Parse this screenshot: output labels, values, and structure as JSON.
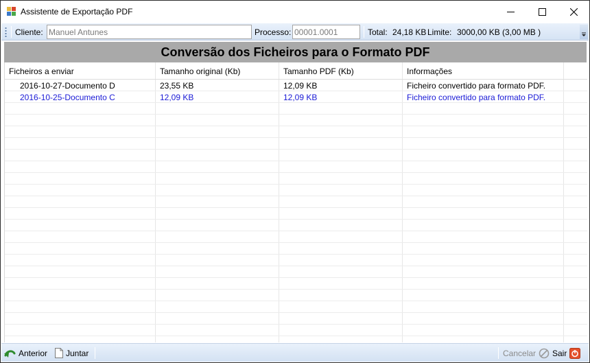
{
  "window": {
    "title": "Assistente de Exportação PDF"
  },
  "toolbar": {
    "cliente_label": "Cliente:",
    "cliente_value": "Manuel Antunes",
    "processo_label": "Processo:",
    "processo_value": "00001.0001",
    "total_label": "Total:",
    "total_value": "24,18 KB",
    "limite_label": "Limite:",
    "limite_value": "3000,00 KB (3,00 MB )"
  },
  "banner": {
    "title": "Conversão dos Ficheiros para o Formato PDF"
  },
  "table": {
    "headers": [
      "Ficheiros a enviar",
      "Tamanho original (Kb)",
      "Tamanho PDF (Kb)",
      "Informações"
    ],
    "rows": [
      {
        "name": "2016-10-27-Documento D",
        "original": "23,55 KB",
        "pdf": "12,09 KB",
        "info": "Ficheiro convertido para formato PDF.",
        "highlight": false
      },
      {
        "name": "2016-10-25-Documento C",
        "original": "12,09 KB",
        "pdf": "12,09 KB",
        "info": "Ficheiro convertido para formato PDF.",
        "highlight": true
      }
    ]
  },
  "statusbar": {
    "anterior_label": "Anterior",
    "juntar_label": "Juntar",
    "cancelar_label": "Cancelar",
    "sair_label": "Sair"
  },
  "colors": {
    "highlight_text": "#1a1ad6",
    "banner_bg": "#a9a9a9",
    "toolbar_bg": "#dde8f6"
  }
}
